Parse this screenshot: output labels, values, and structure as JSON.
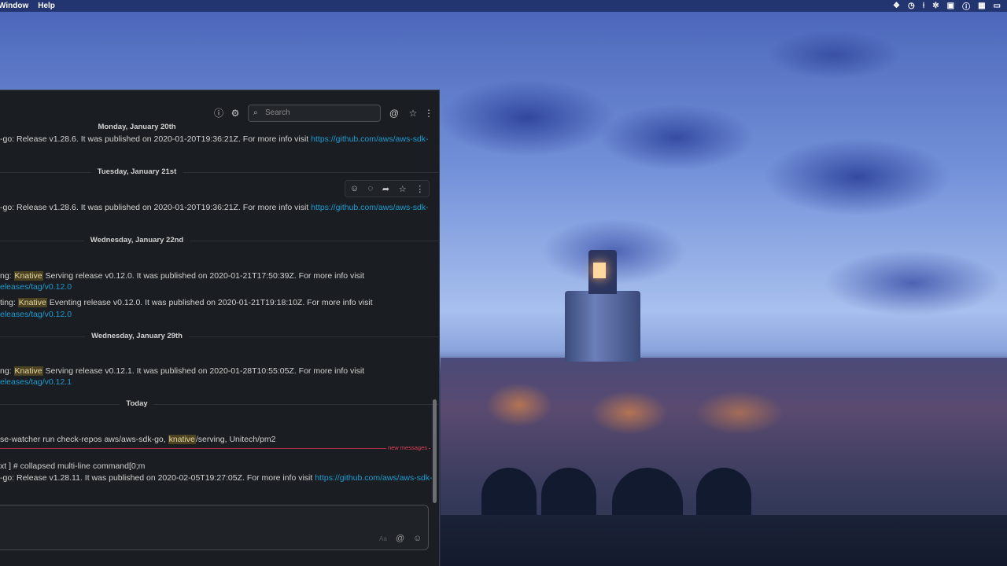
{
  "menubar": {
    "items": [
      "Window",
      "Help"
    ],
    "tray_icons": [
      "dropbox-icon",
      "clock-icon",
      "pin-icon",
      "gear-icon",
      "calendar-icon",
      "info-icon",
      "grid-icon",
      "screen-icon"
    ]
  },
  "header": {
    "search_placeholder": "Search",
    "icons": [
      "info-icon",
      "settings-icon",
      "mention-icon",
      "star-icon",
      "more-icon"
    ]
  },
  "days": [
    {
      "label": "Monday, January 20th"
    },
    {
      "label": "Tuesday, January 21st"
    },
    {
      "label": "Wednesday, January 22nd"
    },
    {
      "label": "Wednesday, January 29th"
    },
    {
      "label": "Today"
    }
  ],
  "messages": {
    "m1": {
      "text": "-go: Release v1.28.6. It was published on 2020-01-20T19:36:21Z. For more info visit ",
      "link": "https://github.com/aws/aws-sdk-"
    },
    "m2": {
      "text": "-go: Release v1.28.6. It was published on 2020-01-20T19:36:21Z. For more info visit ",
      "link": "https://github.com/aws/aws-sdk-"
    },
    "m3": {
      "pre": "ng: ",
      "hl": "Knative",
      "post": " Serving release v0.12.0. It was published on 2020-01-21T17:50:39Z. For more info visit",
      "link2": "eleases/tag/v0.12.0"
    },
    "m4": {
      "pre": "ting: ",
      "hl": "Knative",
      "post": " Eventing release v0.12.0. It was published on 2020-01-21T19:18:10Z. For more info visit",
      "link2": "eleases/tag/v0.12.0"
    },
    "m5": {
      "pre": "ng: ",
      "hl": "Knative",
      "post": " Serving release v0.12.1. It was published on 2020-01-28T10:55:05Z. For more info visit",
      "link2": "eleases/tag/v0.12.1"
    },
    "m6": {
      "pre": "se-watcher run check-repos aws/aws-sdk-go, ",
      "hl": "knative",
      "post": "/serving, Unitech/pm2"
    },
    "m7": {
      "text": "xt ] # collapsed multi-line command[0;m"
    },
    "m8": {
      "text": "-go: Release v1.28.11. It was published on 2020-02-05T19:27:05Z. For more info visit ",
      "link": "https://github.com/aws/aws-sdk-"
    }
  },
  "hover_actions": [
    "add-reaction-icon",
    "reply-thread-icon",
    "share-icon",
    "star-icon",
    "more-icon"
  ],
  "new_messages_label": "new messages",
  "composer": {
    "format_label": "Aa",
    "icons": [
      "mention-icon",
      "emoji-icon"
    ]
  },
  "colors": {
    "link": "#1d9bd1",
    "new_messages": "#e23e57",
    "highlight_bg": "#4a4221",
    "window_bg": "#1a1d21"
  }
}
